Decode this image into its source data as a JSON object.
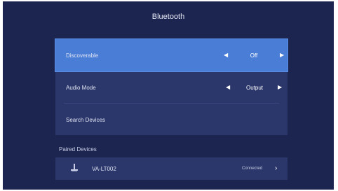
{
  "title": "Bluetooth",
  "settings": [
    {
      "label": "Discoverable",
      "value": "Off"
    },
    {
      "label": "Audio Mode",
      "value": "Output"
    },
    {
      "label": "Search Devices"
    }
  ],
  "paired": {
    "header": "Paired Devices",
    "devices": [
      {
        "name": "VA-LT002",
        "status": "Connected",
        "icon": "device-icon"
      }
    ]
  },
  "colors": {
    "background": "#1c2550",
    "panel": "#2b376a",
    "highlight": "#4a7dd6"
  }
}
